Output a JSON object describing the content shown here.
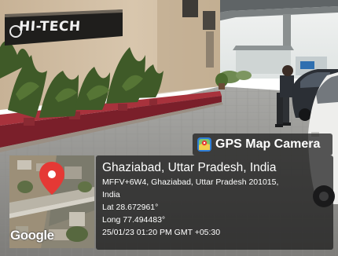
{
  "overlay": {
    "app_name": "GPS Map Camera",
    "map_attribution": "Google"
  },
  "scene": {
    "sign_text": "HI-TECH"
  },
  "location": {
    "title": "Ghaziabad, Uttar Pradesh, India",
    "address_line1": "MFFV+6W4, Ghaziabad, Uttar Pradesh 201015,",
    "address_line2": "India",
    "latitude": "Lat 28.672961°",
    "longitude": "Long 77.494483°",
    "datetime": "25/01/23 01:20 PM GMT +05:30"
  },
  "colors": {
    "pin_red": "#e53935",
    "panel_bg": "#191919"
  }
}
